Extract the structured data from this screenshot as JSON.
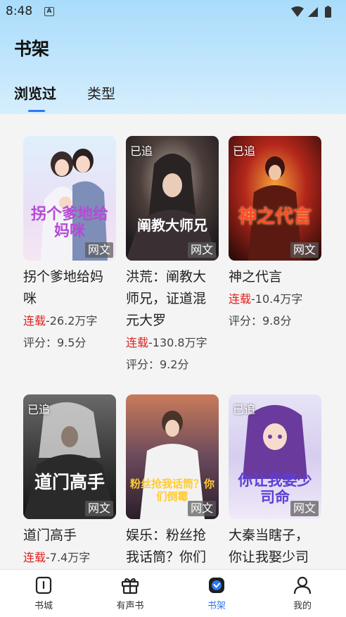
{
  "status_bar": {
    "time": "8:48",
    "notification_icon": "A"
  },
  "header": {
    "title": "书架"
  },
  "tabs": [
    {
      "label": "浏览过",
      "active": true
    },
    {
      "label": "类型",
      "active": false
    }
  ],
  "books": [
    {
      "title": "拐个爹地给妈咪",
      "badge": "",
      "source_tag": "网文",
      "cover_text": "拐个爹地给妈咪",
      "status": "连载",
      "word_count": "-26.2万字",
      "rating": "评分：9.5分"
    },
    {
      "title": "洪荒：阐教大师兄，证道混元大罗",
      "badge": "已追",
      "source_tag": "网文",
      "cover_text": "阐教大师兄",
      "status": "连载",
      "word_count": "-130.8万字",
      "rating": "评分：9.2分"
    },
    {
      "title": "神之代言",
      "badge": "已追",
      "source_tag": "网文",
      "cover_text": "神之代言",
      "status": "连载",
      "word_count": "-10.4万字",
      "rating": "评分：9.8分"
    },
    {
      "title": "道门高手",
      "badge": "已追",
      "source_tag": "网文",
      "cover_text": "道门高手",
      "status": "连载",
      "word_count": "-7.4万字",
      "rating": ""
    },
    {
      "title": "娱乐：粉丝抢我话筒？你们",
      "badge": "",
      "source_tag": "网文",
      "cover_text": "粉丝抢我话筒？你们倒霉",
      "status": "",
      "word_count": "",
      "rating": ""
    },
    {
      "title": "大秦当瞎子，你让我娶少司",
      "badge": "已追",
      "source_tag": "网文",
      "cover_text": "你让我娶少司命",
      "status": "",
      "word_count": "",
      "rating": ""
    }
  ],
  "bottom_nav": [
    {
      "label": "书城",
      "icon": "bookstore-icon",
      "active": false
    },
    {
      "label": "有声书",
      "icon": "gift-box-icon",
      "active": false
    },
    {
      "label": "书架",
      "icon": "bookshelf-icon",
      "active": true
    },
    {
      "label": "我的",
      "icon": "person-icon",
      "active": false
    }
  ],
  "colors": {
    "accent": "#2d79f3",
    "status_red": "#e02020",
    "header_gradient_top": "#a9dcfb"
  }
}
